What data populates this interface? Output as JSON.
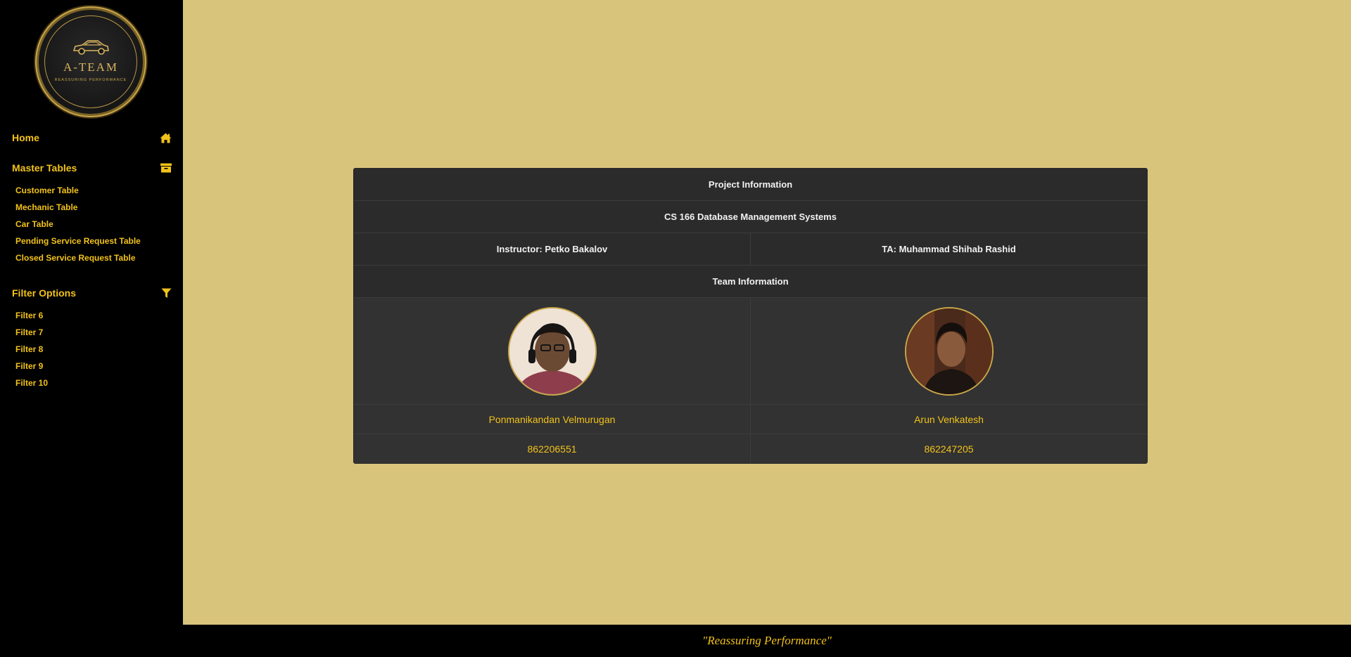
{
  "logo": {
    "brand": "A-TEAM",
    "tagline": "REASSURING PERFORMANCE"
  },
  "sidebar": {
    "home": {
      "label": "Home",
      "icon": "home-icon"
    },
    "master_tables": {
      "label": "Master Tables",
      "icon": "archive-icon",
      "items": [
        {
          "label": "Customer Table"
        },
        {
          "label": "Mechanic Table"
        },
        {
          "label": "Car Table"
        },
        {
          "label": "Pending Service Request Table"
        },
        {
          "label": "Closed Service Request Table"
        }
      ]
    },
    "filter_options": {
      "label": "Filter Options",
      "icon": "filter-icon",
      "items": [
        {
          "label": "Filter 6"
        },
        {
          "label": "Filter 7"
        },
        {
          "label": "Filter 8"
        },
        {
          "label": "Filter 9"
        },
        {
          "label": "Filter 10"
        }
      ]
    }
  },
  "card": {
    "project_header": "Project Information",
    "course": "CS 166 Database Management Systems",
    "instructor": "Instructor: Petko Bakalov",
    "ta": "TA: Muhammad Shihab Rashid",
    "team_header": "Team Information",
    "members": [
      {
        "name": "Ponmanikandan Velmurugan",
        "id": "862206551"
      },
      {
        "name": "Arun Venkatesh",
        "id": "862247205"
      }
    ]
  },
  "footer": {
    "quote": "\"Reassuring Performance\""
  },
  "colors": {
    "accent": "#f2c21a",
    "background": "#d9c47c",
    "sidebar": "#000000",
    "card": "#2d2d2d"
  }
}
